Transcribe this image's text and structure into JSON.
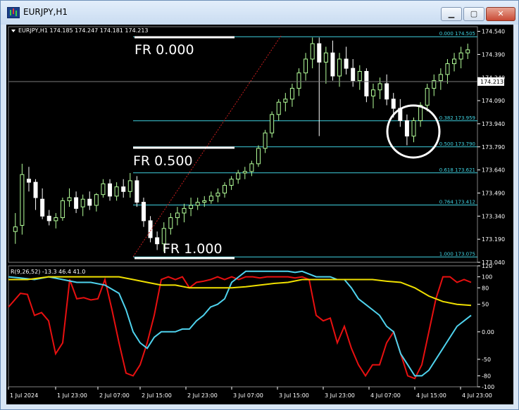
{
  "window": {
    "title": "EURJPY,H1",
    "buttons": [
      "minimize",
      "maximize",
      "close"
    ]
  },
  "colors": {
    "background": "#000000",
    "bull_candle": "#b4ff9a",
    "bear_candle": "#ffffff",
    "fib_level": "#3fd1e0",
    "fib_trend": "#c81e1e",
    "rsi": "#e81010",
    "fast_line": "#4fd3ee",
    "slow_line": "#f0e000",
    "axis_text": "#ffffff",
    "price_label_bg": "#ffffff"
  },
  "main_chart": {
    "header": "EURJPY,H1  174.185 174.247 174.181 174.213",
    "current_price": "174.213",
    "price_ticks": [
      "174.540",
      "174.390",
      "174.240",
      "174.090",
      "173.940",
      "173.790",
      "173.640",
      "173.490",
      "173.340",
      "173.190",
      "173.040"
    ],
    "fib_levels": [
      {
        "label": "0.000  174.505",
        "price": 174.505
      },
      {
        "label": "0.382  173.959",
        "price": 173.959
      },
      {
        "label": "0.500  173.790",
        "price": 173.79
      },
      {
        "label": "0.618  173.621",
        "price": 173.621
      },
      {
        "label": "0.764  173.412",
        "price": 173.412
      },
      {
        "label": "1.000  173.075",
        "price": 173.075
      }
    ],
    "annotations": [
      "FR 0.000",
      "FR 0.500",
      "FR 1.000"
    ]
  },
  "indicator": {
    "header": "R(9,26,52) -13.3 46.4 41.0",
    "ticks": [
      "120",
      "100",
      "80",
      "50",
      "0.00",
      "-50",
      "-80",
      "-100"
    ]
  },
  "time_axis": [
    "1 Jul 2024",
    "1 Jul 23:00",
    "2 Jul 07:00",
    "2 Jul 15:00",
    "2 Jul 23:00",
    "3 Jul 07:00",
    "3 Jul 15:00",
    "3 Jul 23:00",
    "4 Jul 07:00",
    "4 Jul 15:00",
    "4 Jul 23:00"
  ],
  "chart_data": {
    "type": "candlestick",
    "title": "EURJPY,H1",
    "ylim": [
      173.04,
      174.57
    ],
    "candles": [
      [
        173.24,
        173.36,
        173.16,
        173.27
      ],
      [
        173.28,
        173.68,
        173.22,
        173.61
      ],
      [
        173.58,
        173.66,
        173.5,
        173.56
      ],
      [
        173.56,
        173.58,
        173.38,
        173.46
      ],
      [
        173.45,
        173.52,
        173.32,
        173.34
      ],
      [
        173.34,
        173.38,
        173.28,
        173.31
      ],
      [
        173.31,
        173.36,
        173.26,
        173.33
      ],
      [
        173.33,
        173.46,
        173.31,
        173.44
      ],
      [
        173.44,
        173.52,
        173.4,
        173.46
      ],
      [
        173.46,
        173.5,
        173.36,
        173.39
      ],
      [
        173.4,
        173.48,
        173.34,
        173.45
      ],
      [
        173.45,
        173.5,
        173.38,
        173.41
      ],
      [
        173.41,
        173.49,
        173.37,
        173.48
      ],
      [
        173.48,
        173.58,
        173.46,
        173.55
      ],
      [
        173.55,
        173.58,
        173.44,
        173.47
      ],
      [
        173.47,
        173.56,
        173.44,
        173.53
      ],
      [
        173.53,
        173.58,
        173.46,
        173.5
      ],
      [
        173.5,
        173.62,
        173.46,
        173.57
      ],
      [
        173.57,
        173.6,
        173.4,
        173.43
      ],
      [
        173.43,
        173.46,
        173.27,
        173.31
      ],
      [
        173.31,
        173.34,
        173.17,
        173.2
      ],
      [
        173.2,
        173.24,
        173.12,
        173.16
      ],
      [
        173.16,
        173.3,
        173.11,
        173.26
      ],
      [
        173.26,
        173.36,
        173.22,
        173.33
      ],
      [
        173.33,
        173.4,
        173.28,
        173.36
      ],
      [
        173.36,
        173.42,
        173.3,
        173.39
      ],
      [
        173.39,
        173.46,
        173.34,
        173.41
      ],
      [
        173.41,
        173.46,
        173.38,
        173.43
      ],
      [
        173.43,
        173.47,
        173.4,
        173.44
      ],
      [
        173.44,
        173.5,
        173.42,
        173.47
      ],
      [
        173.47,
        173.52,
        173.43,
        173.49
      ],
      [
        173.49,
        173.56,
        173.46,
        173.54
      ],
      [
        173.54,
        173.6,
        173.51,
        173.58
      ],
      [
        173.58,
        173.64,
        173.55,
        173.62
      ],
      [
        173.62,
        173.66,
        173.58,
        173.63
      ],
      [
        173.63,
        173.7,
        173.6,
        173.68
      ],
      [
        173.68,
        173.8,
        173.66,
        173.78
      ],
      [
        173.78,
        173.9,
        173.75,
        173.88
      ],
      [
        173.88,
        174.02,
        173.85,
        174.0
      ],
      [
        174.0,
        174.1,
        173.96,
        174.08
      ],
      [
        174.08,
        174.14,
        174.02,
        174.1
      ],
      [
        174.1,
        174.2,
        174.05,
        174.17
      ],
      [
        174.17,
        174.3,
        174.12,
        174.27
      ],
      [
        174.27,
        174.4,
        174.22,
        174.36
      ],
      [
        174.36,
        174.5,
        174.3,
        174.46
      ],
      [
        174.46,
        174.5,
        173.86,
        174.34
      ],
      [
        174.34,
        174.44,
        174.2,
        174.4
      ],
      [
        174.4,
        174.48,
        174.22,
        174.25
      ],
      [
        174.25,
        174.4,
        174.18,
        174.36
      ],
      [
        174.36,
        174.44,
        174.26,
        174.3
      ],
      [
        174.3,
        174.36,
        174.18,
        174.22
      ],
      [
        174.22,
        174.32,
        174.16,
        174.28
      ],
      [
        174.28,
        174.3,
        174.08,
        174.12
      ],
      [
        174.12,
        174.2,
        174.04,
        174.16
      ],
      [
        174.16,
        174.24,
        174.1,
        174.2
      ],
      [
        174.2,
        174.26,
        174.06,
        174.1
      ],
      [
        174.1,
        174.14,
        173.98,
        174.04
      ],
      [
        174.04,
        174.1,
        173.92,
        173.96
      ],
      [
        173.96,
        174.0,
        173.8,
        173.86
      ],
      [
        173.86,
        173.98,
        173.82,
        173.96
      ],
      [
        173.96,
        174.08,
        173.92,
        174.06
      ],
      [
        174.06,
        174.2,
        174.02,
        174.17
      ],
      [
        174.17,
        174.26,
        174.12,
        174.22
      ],
      [
        174.22,
        174.3,
        174.16,
        174.26
      ],
      [
        174.26,
        174.36,
        174.2,
        174.33
      ],
      [
        174.33,
        174.4,
        174.28,
        174.36
      ],
      [
        174.36,
        174.44,
        174.3,
        174.4
      ],
      [
        174.4,
        174.46,
        174.36,
        174.42
      ]
    ]
  }
}
